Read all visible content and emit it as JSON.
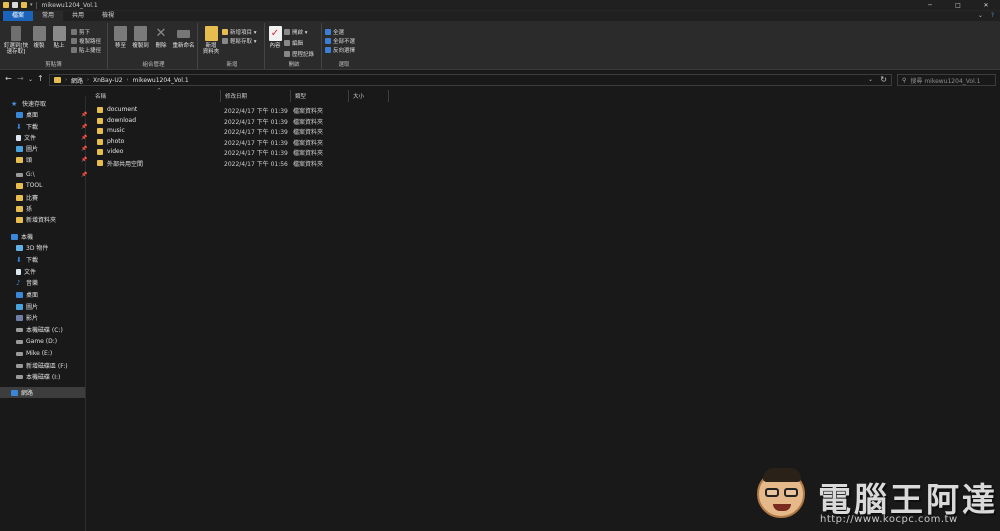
{
  "titlebar": {
    "title": "mikewu1204_Vol.1",
    "btn_min": "─",
    "btn_max": "□",
    "btn_close": "✕"
  },
  "ribbon_tabs": {
    "file": "檔案",
    "home": "常用",
    "share": "共用",
    "view": "檢視",
    "expand": "⌄",
    "help": "?"
  },
  "ribbon": {
    "clipboard": {
      "label": "剪貼簿",
      "pin": "釘選到[快速存取]",
      "copy": "複製",
      "paste": "貼上",
      "cut": "剪下",
      "copy_path": "複製路徑",
      "paste_shortcut": "貼上捷徑"
    },
    "organize": {
      "label": "組合管理",
      "move_to": "移至",
      "copy_to": "複製到",
      "delete": "刪除",
      "rename": "重新命名"
    },
    "new": {
      "label": "新增",
      "new_folder": "新增\n資料夾",
      "new_item": "新增項目 ▾",
      "easy_access": "輕鬆存取 ▾"
    },
    "open": {
      "label": "開啟",
      "properties": "內容",
      "open": "開啟 ▾",
      "edit": "編輯",
      "history": "歷程記錄"
    },
    "select": {
      "label": "選取",
      "select_all": "全選",
      "select_none": "全部不選",
      "invert": "反向選擇"
    }
  },
  "address": {
    "back": "←",
    "forward": "→",
    "recent": "⌄",
    "up": "↑",
    "crumbs": [
      "網路",
      "XnBay-U2",
      "mikewu1204_Vol.1"
    ],
    "search_placeholder": "搜尋 mikewu1204_Vol.1"
  },
  "nav": {
    "quick_access": "快速存取",
    "quick_items": [
      "桌面",
      "下載",
      "文件",
      "圖片",
      "頭",
      "G:\\",
      "TOOL",
      "比賽",
      "孫",
      "新增資料夾"
    ],
    "this_pc": "本機",
    "pc_items": [
      "3D 物件",
      "下載",
      "文件",
      "音樂",
      "桌面",
      "圖片",
      "影片",
      "本機磁碟 (C:)",
      "Game (D:)",
      "Mike (E:)",
      "新增磁碟區 (F:)",
      "本機磁碟 (I:)"
    ],
    "network": "網路"
  },
  "columns": {
    "name": "名稱",
    "date": "修改日期",
    "type": "類型",
    "size": "大小"
  },
  "files": [
    {
      "name": "document",
      "date": "2022/4/17 下午 01:39",
      "type": "檔案資料夾"
    },
    {
      "name": "download",
      "date": "2022/4/17 下午 01:39",
      "type": "檔案資料夾"
    },
    {
      "name": "music",
      "date": "2022/4/17 下午 01:39",
      "type": "檔案資料夾"
    },
    {
      "name": "photo",
      "date": "2022/4/17 下午 01:39",
      "type": "檔案資料夾"
    },
    {
      "name": "video",
      "date": "2022/4/17 下午 01:39",
      "type": "檔案資料夾"
    },
    {
      "name": "外部共用空間",
      "date": "2022/4/17 下午 01:56",
      "type": "檔案資料夾"
    }
  ],
  "watermark": {
    "title": "電腦王阿達",
    "url": "http://www.kocpc.com.tw"
  },
  "colors": {
    "folder": "#e8bd4f",
    "accent": "#1a63b8",
    "background": "#191919",
    "ribbon": "#2b2b2b"
  }
}
